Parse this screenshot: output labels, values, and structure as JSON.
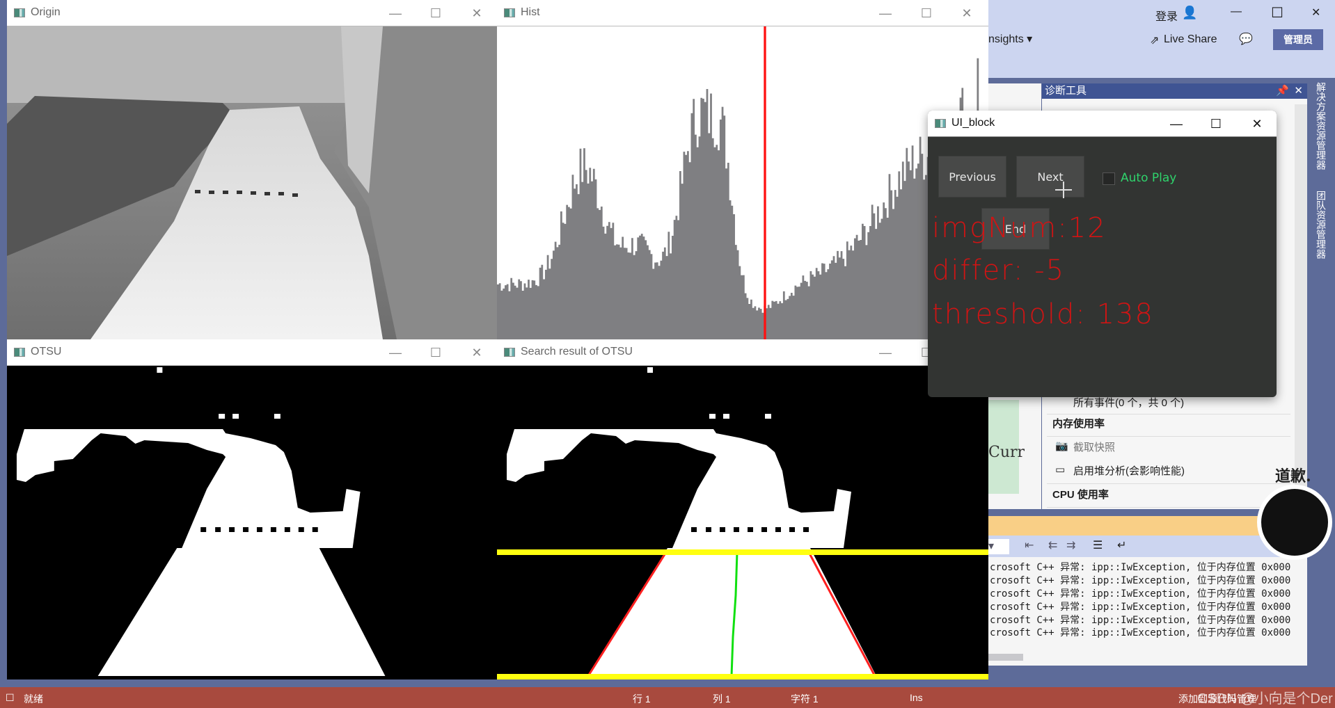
{
  "windows": {
    "origin": {
      "title": "Origin"
    },
    "hist": {
      "title": "Hist",
      "threshold_bin": 138
    },
    "otsu": {
      "title": "OTSU"
    },
    "search": {
      "title": "Search result of OTSU"
    },
    "ui_block": {
      "title": "UI_block",
      "previous_label": "Previous",
      "next_label": "Next",
      "end_label": "End",
      "auto_play_label": "Auto Play",
      "auto_play_checked": false,
      "img_num": "imgNum:12",
      "differ": "differ: -5",
      "threshold": "threshold: 138",
      "colors": {
        "stats": "#d01414",
        "auto_play": "#2fd36c",
        "background": "#323432"
      }
    }
  },
  "vs": {
    "login": "登录",
    "insights": "nsights ▾",
    "live_share": "Live Share",
    "admin": "管理员",
    "diag_title": "诊断工具",
    "side_tabs": [
      "解决方案资源管理器",
      "团队资源管理器"
    ],
    "doc_text": "Curr",
    "diag_items": [
      {
        "label": "所有事件(0 个，共 0 个)",
        "icon": "events-icon",
        "bold": false
      },
      {
        "label": "内存使用率",
        "bold": true
      },
      {
        "label": "截取快照",
        "icon": "camera-icon",
        "bold": false
      },
      {
        "label": "启用堆分析(会影响性能)",
        "icon": "heap-icon",
        "bold": false
      },
      {
        "label": "CPU 使用率",
        "bold": true
      }
    ],
    "output_lines": [
      "crosoft C++ 异常: ipp::IwException, 位于内存位置 0x000",
      "crosoft C++ 异常: ipp::IwException, 位于内存位置 0x000",
      "crosoft C++ 异常: ipp::IwException, 位于内存位置 0x000",
      "crosoft C++ 异常: ipp::IwException, 位于内存位置 0x000",
      "crosoft C++ 异常: ipp::IwException, 位于内存位置 0x000",
      "crosoft C++ 异常: ipp::IwException, 位于内存位置 0x000"
    ],
    "sticker_text": "道歉.",
    "status": {
      "ready": "就绪",
      "line": "行 1",
      "col": "列 1",
      "char": "字符 1",
      "ins": "Ins",
      "source_control": "添加到源代码管理",
      "watermark": "CSDN @小向是个Der"
    },
    "colors": {
      "status_bar": "#a84a3e",
      "frame": "#5d6b99",
      "orange_bar": "#f9cf86"
    }
  }
}
